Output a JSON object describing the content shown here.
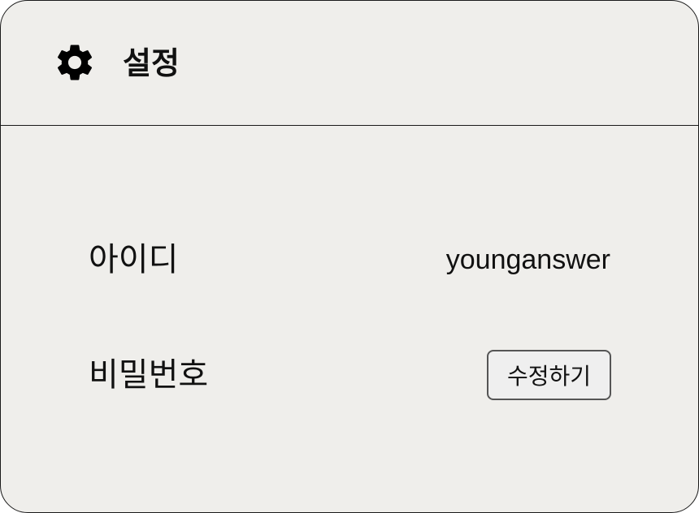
{
  "header": {
    "icon": "gear-icon",
    "title": "설정"
  },
  "settings": {
    "id_label": "아이디",
    "id_value": "younganswer",
    "password_label": "비밀번호",
    "password_edit_label": "수정하기"
  },
  "colors": {
    "panel_background": "#efeeeb",
    "border": "#1a1a1a",
    "text": "#111111"
  }
}
